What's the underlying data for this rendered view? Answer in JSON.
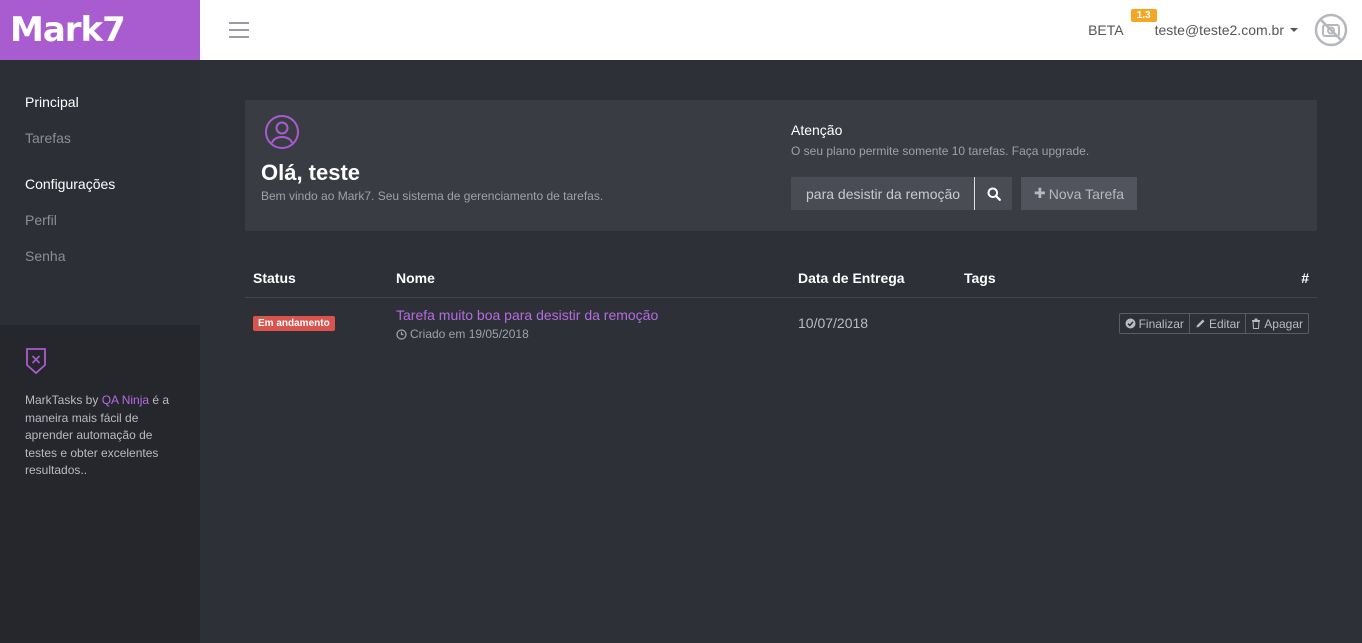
{
  "brand": {
    "logo_text": "Mark7",
    "color": "#a95bd0"
  },
  "topbar": {
    "beta_label": "BETA",
    "version_badge": "1.3",
    "user_email": "teste@teste2.com.br"
  },
  "sidebar": {
    "sections": [
      {
        "heading": "Principal",
        "items": [
          "Tarefas"
        ]
      },
      {
        "heading": "Configurações",
        "items": [
          "Perfil",
          "Senha"
        ]
      }
    ],
    "about": {
      "prefix": "MarkTasks by ",
      "link": "QA Ninja",
      "suffix": " é a maneira mais fácil de aprender automação de testes e obter excelentes resultados.."
    }
  },
  "welcome": {
    "title": "Olá, teste",
    "subtitle": "Bem vindo ao Mark7. Seu sistema de gerenciamento de tarefas."
  },
  "attention": {
    "title": "Atenção",
    "message": "O seu plano permite somente 10 tarefas. Faça upgrade."
  },
  "search": {
    "value": "para desistir da remoção"
  },
  "new_task_label": "Nova Tarefa",
  "table": {
    "headers": {
      "status": "Status",
      "name": "Nome",
      "due": "Data de Entrega",
      "tags": "Tags",
      "actions": "#"
    },
    "rows": [
      {
        "status": "Em andamento",
        "name": "Tarefa muito boa para desistir da remoção",
        "created": "Criado em 19/05/2018",
        "due": "10/07/2018",
        "actions": {
          "finish": "Finalizar",
          "edit": "Editar",
          "delete": "Apagar"
        }
      }
    ]
  },
  "colors": {
    "accent": "#b56be0",
    "status_in_progress": "#d9534f",
    "badge": "#f5a623"
  }
}
